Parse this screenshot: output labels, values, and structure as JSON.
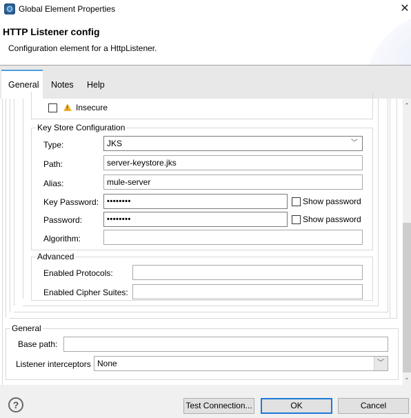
{
  "window": {
    "title": "Global Element Properties",
    "close_icon": "close-icon"
  },
  "header": {
    "title": "HTTP Listener config",
    "description": "Configuration element for a HttpListener."
  },
  "tabs": [
    {
      "label": "General",
      "active": true
    },
    {
      "label": "Notes",
      "active": false
    },
    {
      "label": "Help",
      "active": false
    }
  ],
  "tls": {
    "insecure": {
      "label": "Insecure",
      "checked": false,
      "icon": "warning-icon"
    }
  },
  "key_store": {
    "group_label": "Key Store Configuration",
    "type": {
      "label": "Type:",
      "value": "JKS"
    },
    "path": {
      "label": "Path:",
      "value": "server-keystore.jks"
    },
    "alias": {
      "label": "Alias:",
      "value": "mule-server"
    },
    "key_password": {
      "label": "Key Password:",
      "value": "••••••••",
      "show_label": "Show password",
      "show_checked": false
    },
    "password": {
      "label": "Password:",
      "value": "••••••••",
      "show_label": "Show password",
      "show_checked": false
    },
    "algorithm": {
      "label": "Algorithm:",
      "value": ""
    }
  },
  "advanced": {
    "group_label": "Advanced",
    "enabled_protocols": {
      "label": "Enabled Protocols:",
      "value": ""
    },
    "enabled_cipher_suites": {
      "label": "Enabled Cipher Suites:",
      "value": ""
    }
  },
  "general": {
    "group_label": "General",
    "base_path": {
      "label": "Base path:",
      "value": ""
    },
    "listener_interceptors": {
      "label": "Listener interceptors",
      "value": "None"
    }
  },
  "footer": {
    "help_icon": "help-icon",
    "test_connection_label": "Test Connection...",
    "ok_label": "OK",
    "cancel_label": "Cancel"
  },
  "scrollbar": {
    "up_glyph": "⌃",
    "down_glyph": "⌄"
  }
}
